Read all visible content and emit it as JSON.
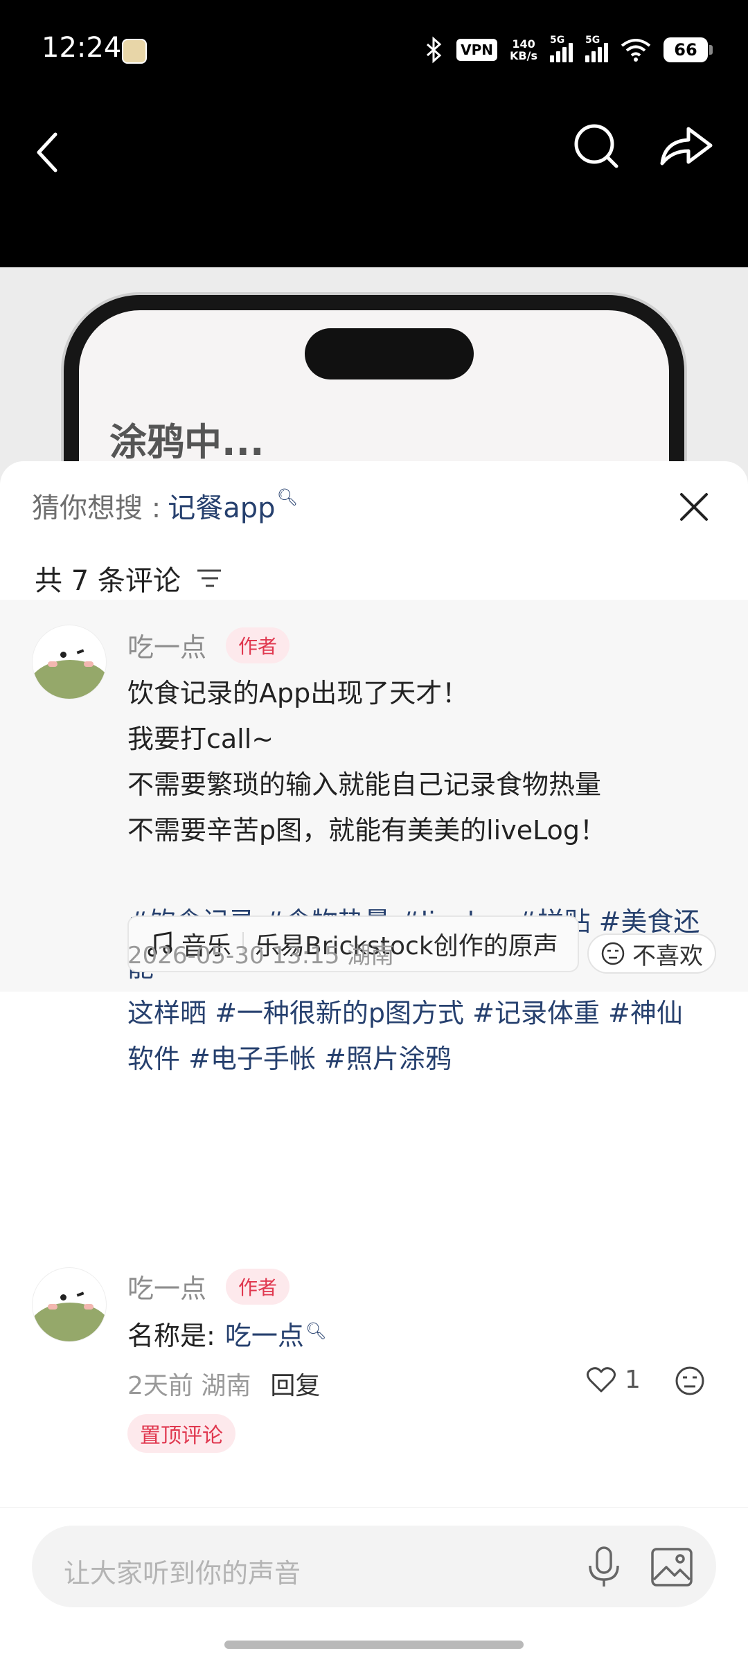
{
  "status_bar": {
    "time": "12:24",
    "vpn": "VPN",
    "net_speed_value": "140",
    "net_speed_unit": "KB/s",
    "signal1_label": "5G",
    "signal2_label": "5G",
    "battery": "66"
  },
  "icons": {
    "back": "chevron-left-icon",
    "search": "search-icon",
    "share": "share-icon",
    "close": "close-icon",
    "filter": "filter-icon",
    "music": "music-note-icon",
    "dislike": "neutral-face-icon",
    "like": "heart-icon",
    "mic": "microphone-icon",
    "image": "image-icon"
  },
  "post_image": {
    "phone_text": "涂鸦中..."
  },
  "sheet": {
    "guess_label": "猜你想搜 :",
    "guess_term": "记餐app",
    "comment_count": "共 7 条评论"
  },
  "pinned_post": {
    "username": "吃一点",
    "author_tag": "作者",
    "lines": [
      "饮食记录的App出现了天才！",
      "我要打call~",
      "不需要繁琐的输入就能自己记录食物热量",
      "不需要辛苦p图，就能有美美的liveLog！"
    ],
    "hashtag_lines": [
      "#饮食记录 #食物热量 #livelog #拼贴 #美食还能",
      "这样晒 #一种很新的p图方式 #记录体重 #神仙",
      "软件 #电子手帐 #照片涂鸦"
    ],
    "music_label": "音乐",
    "music_title": "乐易Brickstock创作的原声",
    "timestamp": "2026-05-30 13:15 湖南",
    "dislike_label": "不喜欢"
  },
  "comment": {
    "username": "吃一点",
    "author_tag": "作者",
    "text_prefix": "名称是:",
    "text_link": "吃一点",
    "time_location": "2天前 湖南",
    "reply_label": "回复",
    "like_count": "1",
    "pinned_label": "置顶评论"
  },
  "input": {
    "placeholder": "让大家听到你的声音"
  },
  "colors": {
    "link": "#26406e",
    "author_tag": "#e0384f",
    "avatar_green": "#95a86a"
  }
}
